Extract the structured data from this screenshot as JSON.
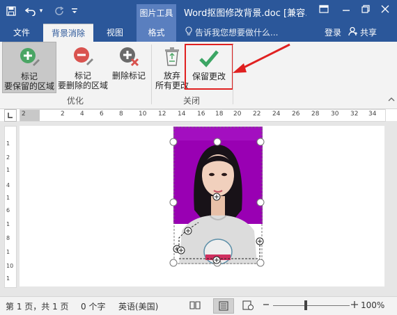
{
  "titlebar": {
    "context_tool": "图片工具",
    "doc_title": "Word抠图修改背景.doc [兼容..."
  },
  "tabs": [
    {
      "label": "文件"
    },
    {
      "label": "背景消除"
    },
    {
      "label": "视图"
    },
    {
      "label": "格式"
    }
  ],
  "tellme": "告诉我您想要做什么...",
  "account": {
    "login": "登录",
    "share": "共享"
  },
  "ribbon": {
    "buttons": {
      "keep": {
        "line1": "标记",
        "line2": "要保留的区域"
      },
      "delete": {
        "line1": "标记",
        "line2": "要删除的区域"
      },
      "delmark": {
        "line1": "删除标记"
      },
      "discard": {
        "line1": "放弃",
        "line2": "所有更改"
      },
      "save": {
        "line1": "保留更改"
      }
    },
    "groups": {
      "optimize": "优化",
      "close": "关闭"
    }
  },
  "ruler": {
    "h_ticks": [
      "2",
      "2",
      "4",
      "6",
      "8",
      "10",
      "12",
      "14",
      "16",
      "18",
      "20",
      "22",
      "24",
      "26",
      "28",
      "30",
      "32",
      "34"
    ],
    "v_ticks": [
      "1",
      "2",
      "1",
      "4",
      "1",
      "6",
      "1",
      "8",
      "1",
      "10",
      "1"
    ]
  },
  "status": {
    "page": "第 1 页，共 1 页",
    "words": "0 个字",
    "lang": "英语(美国)",
    "zoom": "100%"
  },
  "colors": {
    "accent": "#2b579a",
    "photo_bg": "#9900b3",
    "highlight": "#e02020"
  }
}
